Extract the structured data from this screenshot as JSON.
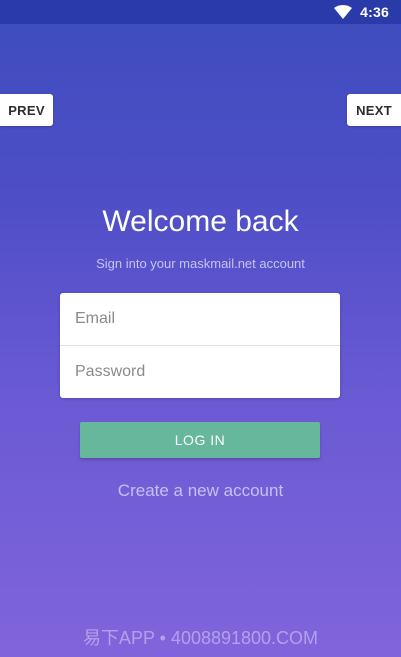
{
  "status_bar": {
    "time": "4:36",
    "icons": [
      "wifi-icon"
    ]
  },
  "nav": {
    "prev_label": "PREV",
    "next_label": "NEXT"
  },
  "header": {
    "title": "Welcome back",
    "subtitle": "Sign into your maskmail.net account"
  },
  "form": {
    "email_placeholder": "Email",
    "password_placeholder": "Password",
    "email_value": "",
    "password_value": ""
  },
  "actions": {
    "login_label": "LOG IN",
    "create_account_label": "Create a new account"
  },
  "watermark": {
    "text": "易下APP • 4008891800.COM"
  },
  "colors": {
    "background_top": "#3d4dbd",
    "background_bottom": "#8064dc",
    "status_bar": "#2a3aa8",
    "login_button": "#66b79b"
  }
}
